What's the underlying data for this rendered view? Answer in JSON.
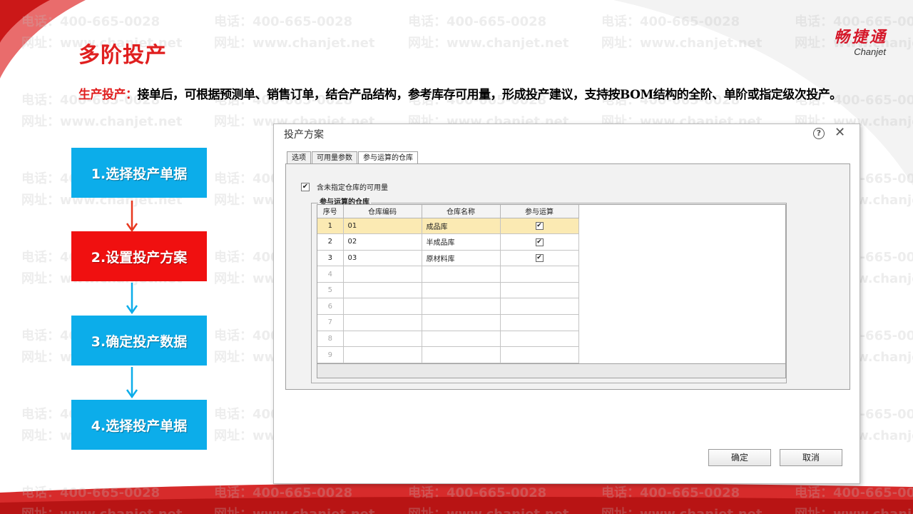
{
  "page": {
    "title": "多阶投产",
    "description_label": "生产投产：",
    "description_text": "接单后，可根据预测单、销售订单，结合产品结构，参考库存可用量，形成投产建议，支持按BOM结构的全阶、单阶或指定级次投产。"
  },
  "logo": {
    "cn": "畅捷通",
    "en": "Chanjet"
  },
  "watermark": {
    "phone": "电话：400-665-0028",
    "site": "网址：www.chanjet.net"
  },
  "steps": [
    {
      "label": "1.选择投产单据",
      "color": "#0cadea"
    },
    {
      "label": "2.设置投产方案",
      "color": "#f01010",
      "active": true
    },
    {
      "label": "3.确定投产数据",
      "color": "#0cadea"
    },
    {
      "label": "4.选择投产单据",
      "color": "#0cadea"
    }
  ],
  "arrows": {
    "first_color": "#e8381f",
    "other_color": "#0cadea"
  },
  "dialog": {
    "title": "投产方案",
    "help_icon": "question-circle-icon",
    "close_icon": "close-icon",
    "tabs": [
      "选项",
      "可用量参数",
      "参与运算的仓库"
    ],
    "active_tab": 2,
    "include_unassigned_label": "含未指定仓库的可用量",
    "include_unassigned_checked": true,
    "group_title": "参与运算的仓库",
    "columns": [
      "序号",
      "仓库编码",
      "仓库名称",
      "参与运算"
    ],
    "rows": [
      {
        "index": "1",
        "code": "01",
        "name": "成品库",
        "checked": true,
        "selected": true
      },
      {
        "index": "2",
        "code": "02",
        "name": "半成品库",
        "checked": true
      },
      {
        "index": "3",
        "code": "03",
        "name": "原材料库",
        "checked": true
      },
      {
        "index": "4",
        "code": "",
        "name": "",
        "checked": false
      },
      {
        "index": "5",
        "code": "",
        "name": "",
        "checked": false
      },
      {
        "index": "6",
        "code": "",
        "name": "",
        "checked": false
      },
      {
        "index": "7",
        "code": "",
        "name": "",
        "checked": false
      },
      {
        "index": "8",
        "code": "",
        "name": "",
        "checked": false
      },
      {
        "index": "9",
        "code": "",
        "name": "",
        "checked": false
      }
    ],
    "ok_label": "确定",
    "cancel_label": "取消"
  }
}
